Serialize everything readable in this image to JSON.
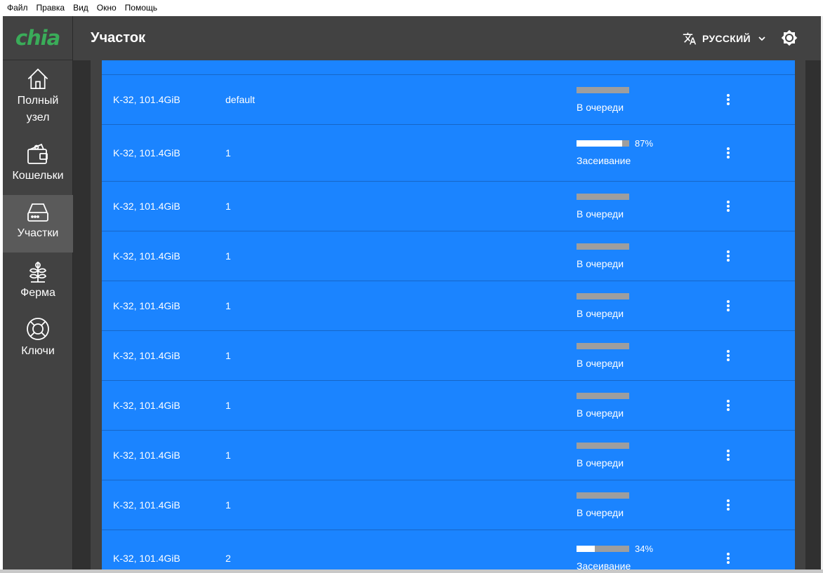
{
  "menubar": {
    "items": [
      "Файл",
      "Правка",
      "Вид",
      "Окно",
      "Помощь"
    ]
  },
  "logo": {
    "text": "chia"
  },
  "sidebar": {
    "items": [
      {
        "label_line1": "Полный",
        "label_line2": "узел",
        "icon": "home-icon"
      },
      {
        "label_line1": "Кошельки",
        "label_line2": "",
        "icon": "wallet-icon"
      },
      {
        "label_line1": "Участки",
        "label_line2": "",
        "icon": "hard-drive-icon",
        "active": true
      },
      {
        "label_line1": "Ферма",
        "label_line2": "",
        "icon": "plant-icon"
      },
      {
        "label_line1": "Ключи",
        "label_line2": "",
        "icon": "lifebuoy-icon"
      }
    ]
  },
  "header": {
    "title": "Участок",
    "language": "РУССКИЙ"
  },
  "colors": {
    "accent_green": "#3aac59",
    "row_blue": "#1b84ff",
    "sidebar_bg": "#424242",
    "content_bg": "#303030"
  },
  "plots": [
    {
      "size": "K-32, 101.4GiB",
      "queue": "default",
      "progress": 0,
      "percent": "",
      "state": "В очереди"
    },
    {
      "size": "K-32, 101.4GiB",
      "queue": "1",
      "progress": 0.87,
      "percent": "87%",
      "state": "Засеивание"
    },
    {
      "size": "K-32, 101.4GiB",
      "queue": "1",
      "progress": 0,
      "percent": "",
      "state": "В очереди"
    },
    {
      "size": "K-32, 101.4GiB",
      "queue": "1",
      "progress": 0,
      "percent": "",
      "state": "В очереди"
    },
    {
      "size": "K-32, 101.4GiB",
      "queue": "1",
      "progress": 0,
      "percent": "",
      "state": "В очереди"
    },
    {
      "size": "K-32, 101.4GiB",
      "queue": "1",
      "progress": 0,
      "percent": "",
      "state": "В очереди"
    },
    {
      "size": "K-32, 101.4GiB",
      "queue": "1",
      "progress": 0,
      "percent": "",
      "state": "В очереди"
    },
    {
      "size": "K-32, 101.4GiB",
      "queue": "1",
      "progress": 0,
      "percent": "",
      "state": "В очереди"
    },
    {
      "size": "K-32, 101.4GiB",
      "queue": "1",
      "progress": 0,
      "percent": "",
      "state": "В очереди"
    },
    {
      "size": "K-32, 101.4GiB",
      "queue": "2",
      "progress": 0.34,
      "percent": "34%",
      "state": "Засеивание"
    }
  ]
}
